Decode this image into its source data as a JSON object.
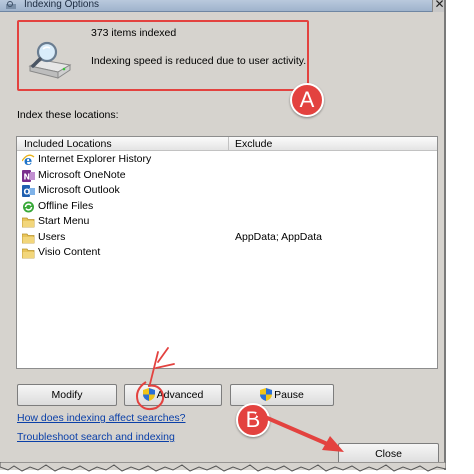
{
  "window": {
    "title": "Indexing Options",
    "close_glyph": "✕"
  },
  "status": {
    "count_text": "373 items indexed",
    "message": "Indexing speed is reduced due to user activity."
  },
  "section_label": "Index these locations:",
  "table": {
    "columns": [
      "Included Locations",
      "Exclude"
    ],
    "rows": [
      {
        "included": "Internet Explorer History",
        "exclude": "",
        "icon": "internet-explorer-icon"
      },
      {
        "included": "Microsoft OneNote",
        "exclude": "",
        "icon": "onenote-icon"
      },
      {
        "included": "Microsoft Outlook",
        "exclude": "",
        "icon": "outlook-icon"
      },
      {
        "included": "Offline Files",
        "exclude": "",
        "icon": "sync-icon"
      },
      {
        "included": "Start Menu",
        "exclude": "",
        "icon": "folder-icon"
      },
      {
        "included": "Users",
        "exclude": "AppData; AppData",
        "icon": "folder-icon"
      },
      {
        "included": "Visio Content",
        "exclude": "",
        "icon": "folder-icon"
      }
    ]
  },
  "buttons": {
    "modify": "Modify",
    "advanced": "Advanced",
    "pause": "Pause",
    "close": "Close"
  },
  "links": {
    "how_indexing": "How does indexing affect searches?",
    "troubleshoot": "Troubleshoot search and indexing"
  },
  "annotations": {
    "a": "A",
    "b": "B"
  },
  "colors": {
    "annotation_red": "#e3423f",
    "link_blue": "#0a3fa8",
    "dialog_bg": "#d6d3ce"
  }
}
